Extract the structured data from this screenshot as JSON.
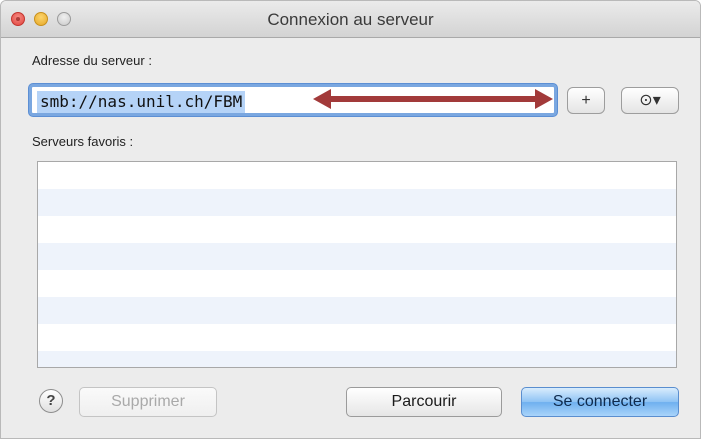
{
  "window": {
    "title": "Connexion au serveur"
  },
  "address": {
    "label": "Adresse du serveur :",
    "value": "smb://nas.unil.ch/FBM",
    "add_label": "+",
    "recent_label": "⊙▾"
  },
  "favorites": {
    "label": "Serveurs favoris :",
    "rows": [
      "",
      "",
      "",
      "",
      "",
      "",
      "",
      ""
    ]
  },
  "footer": {
    "help_label": "?",
    "delete_label": "Supprimer",
    "browse_label": "Parcourir",
    "connect_label": "Se connecter"
  },
  "colors": {
    "annotation_arrow": "#a23a3a",
    "focus_ring": "#7aa7e0"
  }
}
